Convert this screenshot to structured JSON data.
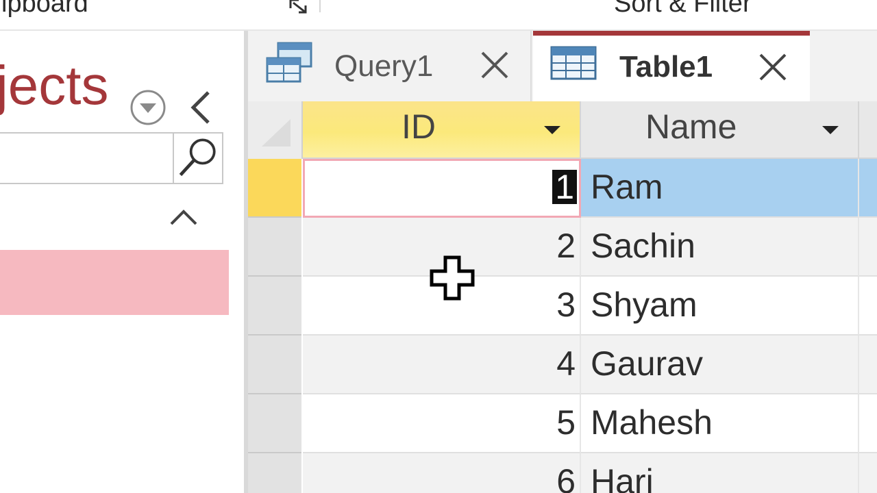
{
  "ribbon": {
    "clipboard_label": "ipboard",
    "sort_filter_label": "Sort & Filter"
  },
  "nav": {
    "title": "jects",
    "search_placeholder": ""
  },
  "tabs": [
    {
      "label": "Query1",
      "active": false
    },
    {
      "label": "Table1",
      "active": true
    }
  ],
  "table": {
    "columns": [
      "ID",
      "Name"
    ],
    "rows": [
      {
        "id": "1",
        "name": "Ram"
      },
      {
        "id": "2",
        "name": "Sachin"
      },
      {
        "id": "3",
        "name": "Shyam"
      },
      {
        "id": "4",
        "name": "Gaurav"
      },
      {
        "id": "5",
        "name": "Mahesh"
      },
      {
        "id": "6",
        "name": "Hari"
      }
    ],
    "current_row": 0
  },
  "colors": {
    "accent": "#a4373a",
    "selected_nav": "#f6b9c0",
    "header_active": "#fbe48a",
    "row_highlight": "#a8d0f0"
  },
  "icons": [
    "dialog-launcher-icon",
    "menu-dropdown-icon",
    "collapse-chevron-icon",
    "search-icon",
    "chevron-up-icon",
    "query-icon",
    "table-icon",
    "close-icon",
    "dropdown-arrow-icon",
    "crosshair-cursor-icon"
  ]
}
